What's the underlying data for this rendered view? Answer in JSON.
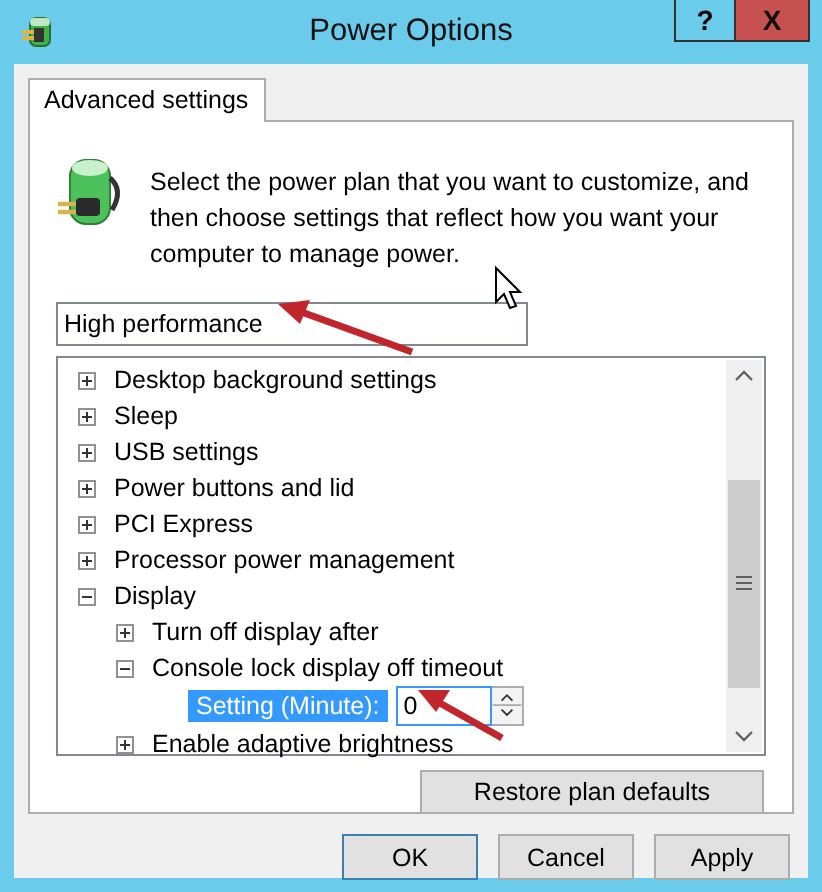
{
  "window": {
    "title": "Power Options",
    "help_button": "?",
    "close_button": "X"
  },
  "tabs": [
    {
      "label": "Advanced settings",
      "selected": true
    }
  ],
  "intro": "Select the power plan that you want to customize, and then choose settings that reflect how you want your computer to manage power.",
  "plan_dropdown": {
    "value": "High performance"
  },
  "tree": {
    "items": [
      {
        "kind": "group",
        "label": "Desktop background settings",
        "expanded": false
      },
      {
        "kind": "group",
        "label": "Sleep",
        "expanded": false
      },
      {
        "kind": "group",
        "label": "USB settings",
        "expanded": false
      },
      {
        "kind": "group",
        "label": "Power buttons and lid",
        "expanded": false
      },
      {
        "kind": "group",
        "label": "PCI Express",
        "expanded": false
      },
      {
        "kind": "group",
        "label": "Processor power management",
        "expanded": false
      },
      {
        "kind": "group",
        "label": "Display",
        "expanded": true,
        "children": [
          {
            "kind": "group",
            "label": "Turn off display after",
            "expanded": false
          },
          {
            "kind": "group",
            "label": "Console lock display off timeout",
            "expanded": true,
            "children": [
              {
                "kind": "setting",
                "label": "Setting (Minute):",
                "value": "0",
                "selected": true
              }
            ]
          },
          {
            "kind": "group",
            "label": "Enable adaptive brightness",
            "expanded": false
          }
        ]
      }
    ]
  },
  "restore_button": "Restore plan defaults",
  "buttons": [
    "OK",
    "Cancel",
    "Apply"
  ]
}
